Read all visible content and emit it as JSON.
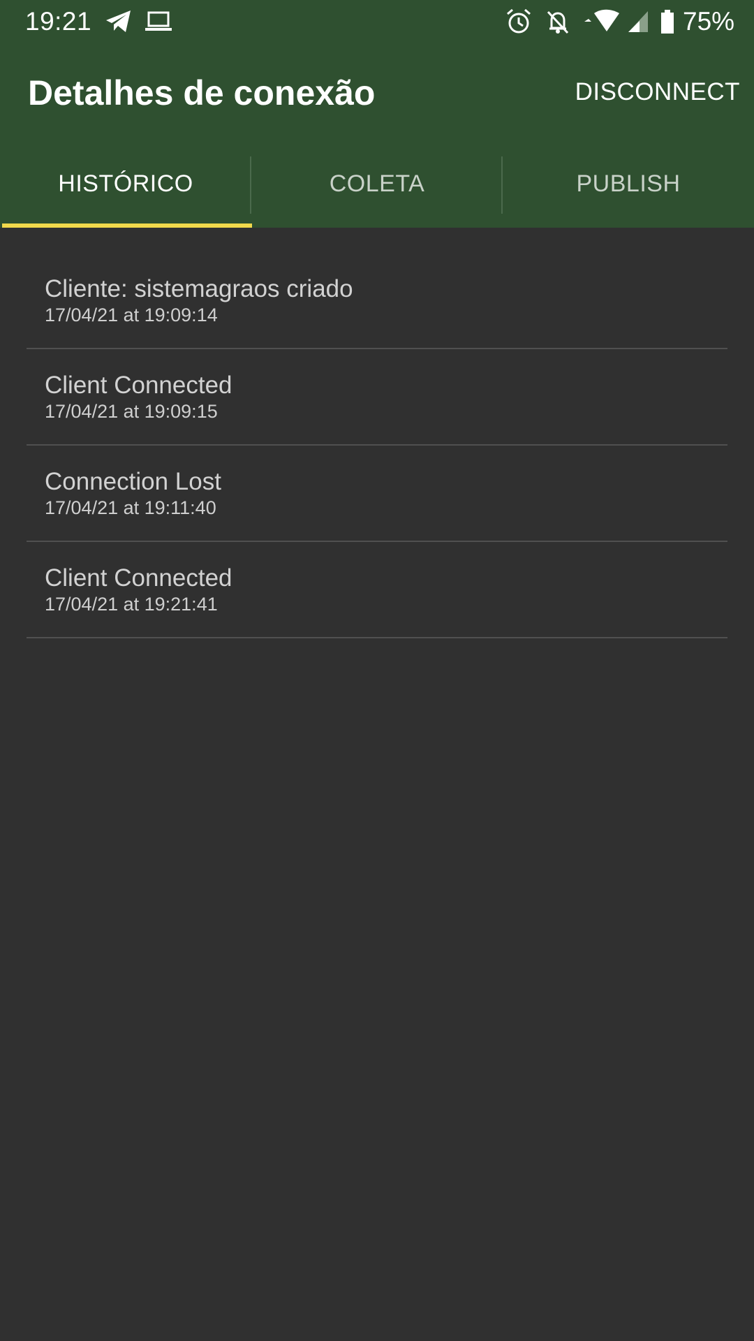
{
  "status_bar": {
    "time": "19:21",
    "battery_percent": "75%",
    "icons": [
      "telegram-icon",
      "laptop-icon",
      "alarm-icon",
      "notifications-off-icon",
      "wifi-icon",
      "cell-signal-icon",
      "battery-icon"
    ]
  },
  "app_bar": {
    "title": "Detalhes de conexão",
    "action_label": "DISCONNECT"
  },
  "tabs": [
    {
      "label": "HISTÓRICO",
      "active": true
    },
    {
      "label": "COLETA",
      "active": false
    },
    {
      "label": "PUBLISH",
      "active": false
    }
  ],
  "history": [
    {
      "title": "Cliente: sistemagraos criado",
      "time": "17/04/21 at 19:09:14"
    },
    {
      "title": "Client Connected",
      "time": "17/04/21 at 19:09:15"
    },
    {
      "title": "Connection Lost",
      "time": "17/04/21 at 19:11:40"
    },
    {
      "title": "Client Connected",
      "time": "17/04/21 at 19:21:41"
    }
  ],
  "colors": {
    "primary": "#2f5030",
    "accent": "#f1d94c",
    "background": "#303030"
  }
}
